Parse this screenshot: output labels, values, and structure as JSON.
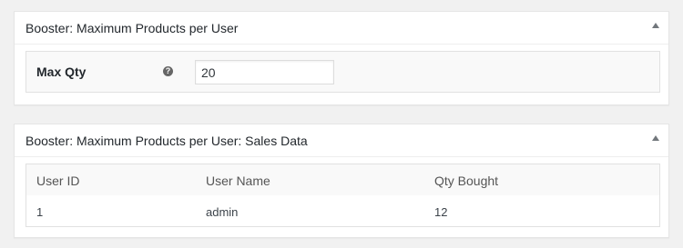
{
  "box1": {
    "title": "Booster: Maximum Products per User",
    "field_label": "Max Qty",
    "help_icon": "?",
    "max_qty_value": "20"
  },
  "box2": {
    "title": "Booster: Maximum Products per User: Sales Data",
    "columns": [
      "User ID",
      "User Name",
      "Qty Bought"
    ],
    "rows": [
      [
        "1",
        "admin",
        "12"
      ]
    ]
  },
  "icons": {
    "toggle": "triangle-up-icon",
    "help": "question-circle-icon"
  }
}
